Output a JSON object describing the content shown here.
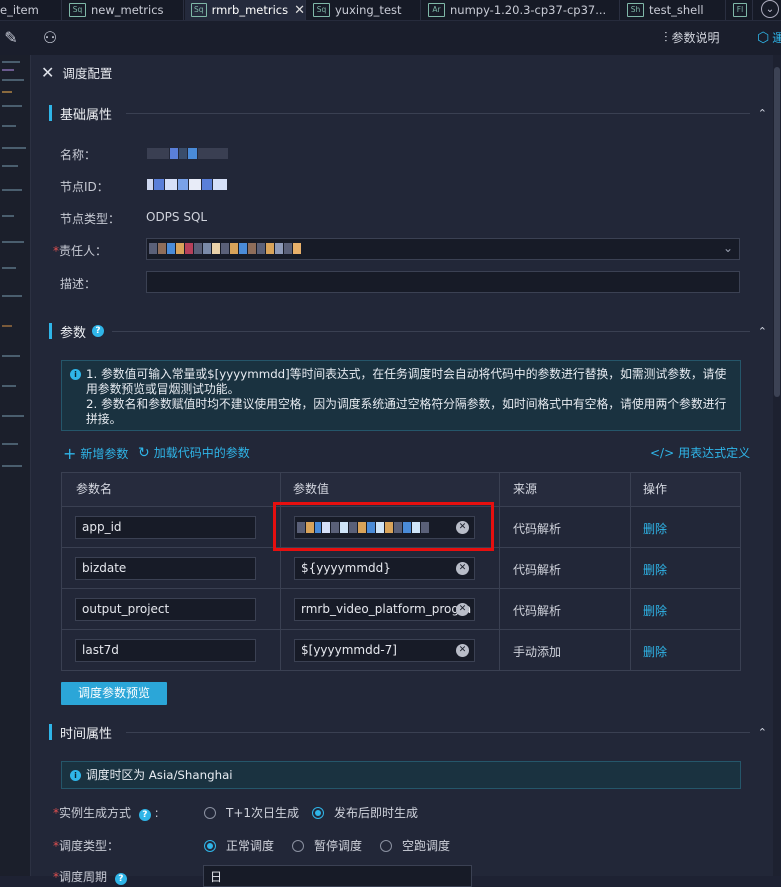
{
  "tabs": [
    {
      "icon": "",
      "label": "se_item"
    },
    {
      "icon": "Sq",
      "label": "new_metrics"
    },
    {
      "icon": "Sq",
      "label": "rmrb_metrics",
      "active": true
    },
    {
      "icon": "Sq",
      "label": "yuxing_test"
    },
    {
      "icon": "Ar",
      "label": "numpy-1.20.3-cp37-cp37..."
    },
    {
      "icon": "Sh",
      "label": "test_shell"
    },
    {
      "icon": "Fl",
      "label": ""
    }
  ],
  "toolbar": {
    "param_help_label": "参数说明",
    "extra_label": "運"
  },
  "panel": {
    "title": "调度配置",
    "basic": {
      "title": "基础属性",
      "name_label": "名称：",
      "node_id_label": "节点ID：",
      "node_type_label": "节点类型：",
      "node_type_value": "ODPS SQL",
      "owner_label": "责任人：",
      "desc_label": "描述："
    },
    "params": {
      "title": "参数",
      "help_icon": "?",
      "info_line1": "1. 参数值可输入常量或$[yyyymmdd]等时间表达式，在任务调度时会自动将代码中的参数进行替换，如需测试参数，请使用参数预览或冒烟测试功能。",
      "info_line2": "2. 参数名和参数赋值时均不建议使用空格，因为调度系统通过空格符分隔参数，如时间格式中有空格，请使用两个参数进行拼接。",
      "add_param": "新增参数",
      "load_params": "加载代码中的参数",
      "expr_define": "用表达式定义",
      "columns": [
        "参数名",
        "参数值",
        "来源",
        "操作"
      ],
      "rows": [
        {
          "name": "app_id",
          "value": "",
          "source": "代码解析",
          "op": "删除"
        },
        {
          "name": "bizdate",
          "value": "${yyyymmdd}",
          "source": "代码解析",
          "op": "删除"
        },
        {
          "name": "output_project",
          "value": "rmrb_video_platform_progra",
          "source": "代码解析",
          "op": "删除"
        },
        {
          "name": "last7d",
          "value": "$[yyyymmdd-7]",
          "source": "手动添加",
          "op": "删除"
        }
      ],
      "preview_button": "调度参数预览"
    },
    "time": {
      "title": "时间属性",
      "timezone_info": "调度时区为 Asia/Shanghai",
      "instance_label": "实例生成方式",
      "instance_options": [
        "T+1次日生成",
        "发布后即时生成"
      ],
      "instance_selected": 1,
      "sched_type_label": "调度类型：",
      "sched_type_options": [
        "正常调度",
        "暂停调度",
        "空跑调度"
      ],
      "sched_type_selected": 0,
      "period_label": "调度周期",
      "period_value": "日"
    }
  },
  "colors": {
    "accent": "#2fb5e8",
    "highlight_box": "#e60f0f",
    "required": "#e05050"
  }
}
